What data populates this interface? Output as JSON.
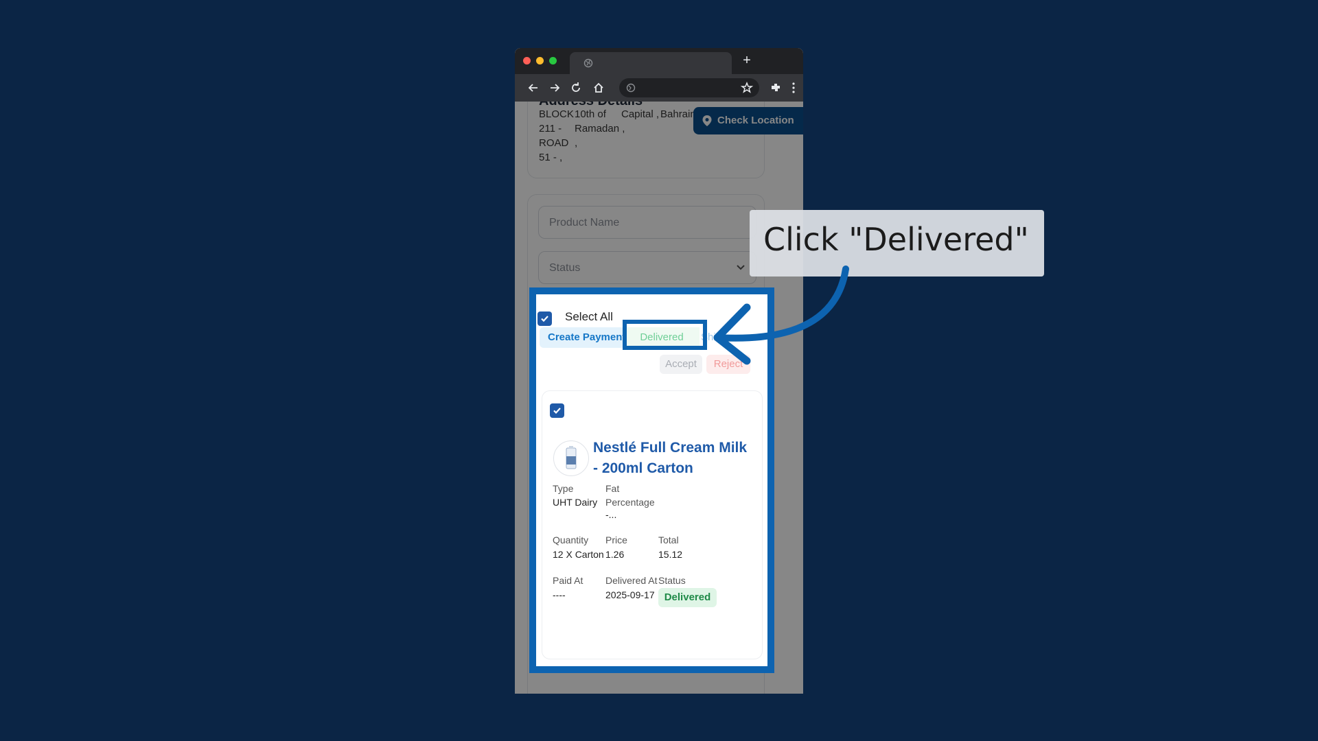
{
  "browser": {
    "tab_title": "",
    "url": ""
  },
  "page": {
    "address_title": "Address Details",
    "address_cols": [
      "BLOCK\n211 -\nROAD\n51 - ,",
      "10th of\nRamadan ,\n,",
      "Capital ,",
      "Bahrain"
    ],
    "check_location_label": "Check Location",
    "product_name_placeholder": "Product Name",
    "status_placeholder": "Status"
  },
  "selection": {
    "select_all_label": "Select All",
    "select_all_checked": true,
    "actions": {
      "create_payment": "Create Payment",
      "delivered": "Delivered",
      "shipped": "Shi",
      "accept": "Accept",
      "reject": "Reject"
    }
  },
  "product": {
    "checked": true,
    "name": "Nestlé Full Cream Milk - 200ml Carton",
    "fields": {
      "type_label": "Type",
      "type_value": "UHT Dairy",
      "fat_label": "Fat Percentage",
      "fat_value": "-...",
      "quantity_label": "Quantity",
      "quantity_value": "12 X Carton",
      "price_label": "Price",
      "price_value": "1.26",
      "total_label": "Total",
      "total_value": "15.12",
      "paid_at_label": "Paid At",
      "paid_at_value": "----",
      "delivered_at_label": "Delivered At",
      "delivered_at_value": "2025-09-17",
      "status_label": "Status",
      "status_value": "Delivered"
    }
  },
  "annotation": {
    "callout_text": "Click \"Delivered\""
  },
  "colors": {
    "background": "#0b2545",
    "highlight": "#0d63b0",
    "brand": "#1f5aa8",
    "delivered_green": "#1f8a48"
  }
}
